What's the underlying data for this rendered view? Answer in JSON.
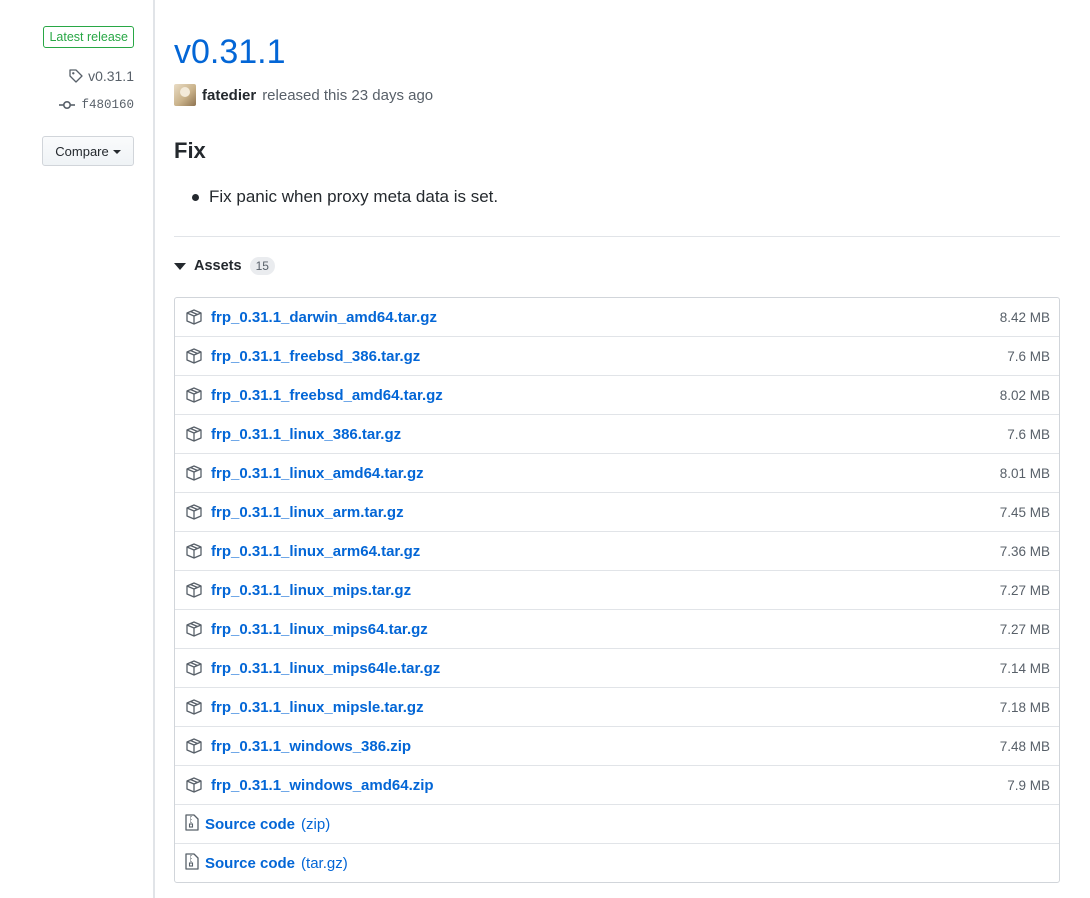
{
  "meta": {
    "latest_label": "Latest release",
    "tag": "v0.31.1",
    "commit": "f480160",
    "compare_label": "Compare"
  },
  "release": {
    "title": "v0.31.1",
    "author": "fatedier",
    "released_text": "released this 23 days ago",
    "section_heading": "Fix",
    "notes": [
      "Fix panic when proxy meta data is set."
    ]
  },
  "assets": {
    "heading": "Assets",
    "count": "15",
    "files": [
      {
        "name": "frp_0.31.1_darwin_amd64.tar.gz",
        "size": "8.42 MB"
      },
      {
        "name": "frp_0.31.1_freebsd_386.tar.gz",
        "size": "7.6 MB"
      },
      {
        "name": "frp_0.31.1_freebsd_amd64.tar.gz",
        "size": "8.02 MB"
      },
      {
        "name": "frp_0.31.1_linux_386.tar.gz",
        "size": "7.6 MB"
      },
      {
        "name": "frp_0.31.1_linux_amd64.tar.gz",
        "size": "8.01 MB"
      },
      {
        "name": "frp_0.31.1_linux_arm.tar.gz",
        "size": "7.45 MB"
      },
      {
        "name": "frp_0.31.1_linux_arm64.tar.gz",
        "size": "7.36 MB"
      },
      {
        "name": "frp_0.31.1_linux_mips.tar.gz",
        "size": "7.27 MB"
      },
      {
        "name": "frp_0.31.1_linux_mips64.tar.gz",
        "size": "7.27 MB"
      },
      {
        "name": "frp_0.31.1_linux_mips64le.tar.gz",
        "size": "7.14 MB"
      },
      {
        "name": "frp_0.31.1_linux_mipsle.tar.gz",
        "size": "7.18 MB"
      },
      {
        "name": "frp_0.31.1_windows_386.zip",
        "size": "7.48 MB"
      },
      {
        "name": "frp_0.31.1_windows_amd64.zip",
        "size": "7.9 MB"
      }
    ],
    "source": [
      {
        "name": "Source code",
        "format": "(zip)"
      },
      {
        "name": "Source code",
        "format": "(tar.gz)"
      }
    ]
  },
  "icons": {
    "tag": "tag-icon",
    "commit": "git-commit-icon",
    "package": "package-icon",
    "archive": "file-zip-icon",
    "disclosure": "triangle-down-icon"
  },
  "colors": {
    "link": "#0366d6",
    "latest": "#28a745",
    "muted": "#586069"
  }
}
